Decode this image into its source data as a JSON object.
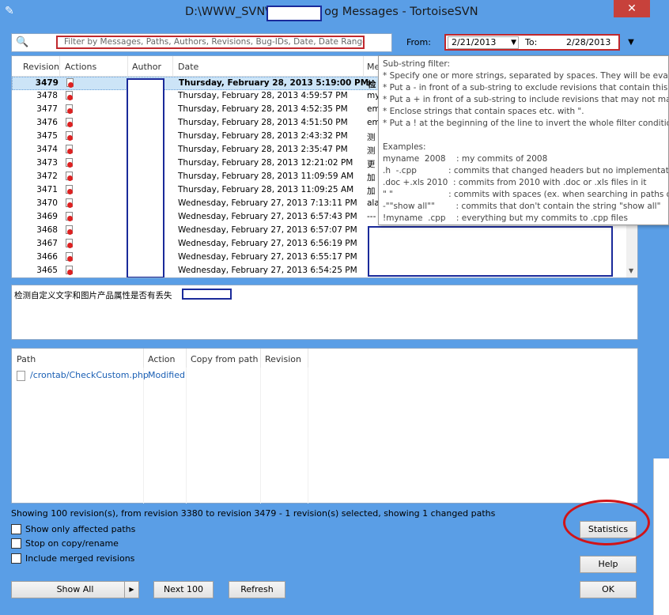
{
  "window": {
    "title_prefix": "D:\\WWW_SVN\\",
    "title_suffix": "og Messages - TortoiseSVN",
    "close_glyph": "✕"
  },
  "filter": {
    "placeholder": "Filter by Messages, Paths, Authors, Revisions, Bug-IDs, Date, Date Range",
    "from_label": "From:",
    "from_value": "2/21/2013",
    "to_label": "To:",
    "to_value": "2/28/2013"
  },
  "log": {
    "columns": [
      "Revision",
      "Actions",
      "Author",
      "Date",
      "Me"
    ],
    "rows": [
      {
        "revision": "3479",
        "date": "Thursday, February 28, 2013 5:19:00 PM",
        "msg": "检"
      },
      {
        "revision": "3478",
        "date": "Thursday, February 28, 2013 4:59:57 PM",
        "msg": "my"
      },
      {
        "revision": "3477",
        "date": "Thursday, February 28, 2013 4:52:35 PM",
        "msg": "em"
      },
      {
        "revision": "3476",
        "date": "Thursday, February 28, 2013 4:51:50 PM",
        "msg": "em"
      },
      {
        "revision": "3475",
        "date": "Thursday, February 28, 2013 2:43:32 PM",
        "msg": "测"
      },
      {
        "revision": "3474",
        "date": "Thursday, February 28, 2013 2:35:47 PM",
        "msg": "测"
      },
      {
        "revision": "3473",
        "date": "Thursday, February 28, 2013 12:21:02 PM",
        "msg": "更"
      },
      {
        "revision": "3472",
        "date": "Thursday, February 28, 2013 11:09:59 AM",
        "msg": "加"
      },
      {
        "revision": "3471",
        "date": "Thursday, February 28, 2013 11:09:25 AM",
        "msg": "加"
      },
      {
        "revision": "3470",
        "date": "Wednesday, February 27, 2013 7:13:11 PM",
        "msg": "ala"
      },
      {
        "revision": "3469",
        "date": "Wednesday, February 27, 2013 6:57:43 PM",
        "msg": "---"
      },
      {
        "revision": "3468",
        "date": "Wednesday, February 27, 2013 6:57:07 PM",
        "msg": ""
      },
      {
        "revision": "3467",
        "date": "Wednesday, February 27, 2013 6:56:19 PM",
        "msg": ""
      },
      {
        "revision": "3466",
        "date": "Wednesday, February 27, 2013 6:55:17 PM",
        "msg": ""
      },
      {
        "revision": "3465",
        "date": "Wednesday, February 27, 2013 6:54:25 PM",
        "msg": ""
      }
    ]
  },
  "tooltip": {
    "lines": [
      "Sub-string filter:",
      "* Specify one or more strings, separated by spaces. They will be evalu",
      "* Put a - in front of a sub-string to exclude revisions that contain this",
      "* Put a + in front of a sub-string to include revisions that may not ma",
      "* Enclose strings that contain spaces etc. with \".",
      "* Put a ! at the beginning of the line to invert the whole filter conditio",
      "",
      "Examples:",
      "myname  2008    : my commits of 2008",
      ".h  -.cpp            : commits that changed headers but no implementat",
      ".doc +.xls 2010  : commits from 2010 with .doc or .xls files in it",
      "\" \"                     : commits with spaces (ex. when searching in paths o",
      "-\"\"show all\"\"        : commits that don't contain the string \"show all\"",
      "!myname  .cpp    : everything but my commits to .cpp files"
    ]
  },
  "message": {
    "text": "检测自定义文字和图片产品属性是否有丢失"
  },
  "paths": {
    "columns": [
      "Path",
      "Action",
      "Copy from path",
      "Revision"
    ],
    "rows": [
      {
        "path": "/crontab/CheckCustom.php",
        "action": "Modified"
      }
    ]
  },
  "status": "Showing 100 revision(s), from revision 3380 to revision 3479 - 1 revision(s) selected, showing 1 changed paths",
  "options": {
    "affected": "Show only affected paths",
    "stop_copy": "Stop on copy/rename",
    "merged": "Include merged revisions"
  },
  "buttons": {
    "show_all": "Show All",
    "next_100": "Next 100",
    "refresh": "Refresh",
    "statistics": "Statistics",
    "help": "Help",
    "ok": "OK"
  },
  "colors": {
    "window_frame": "#5a9ee6",
    "highlight_red": "#c0282d",
    "redaction_blue": "#1a2a9a",
    "selected_row": "#cce4f7"
  }
}
